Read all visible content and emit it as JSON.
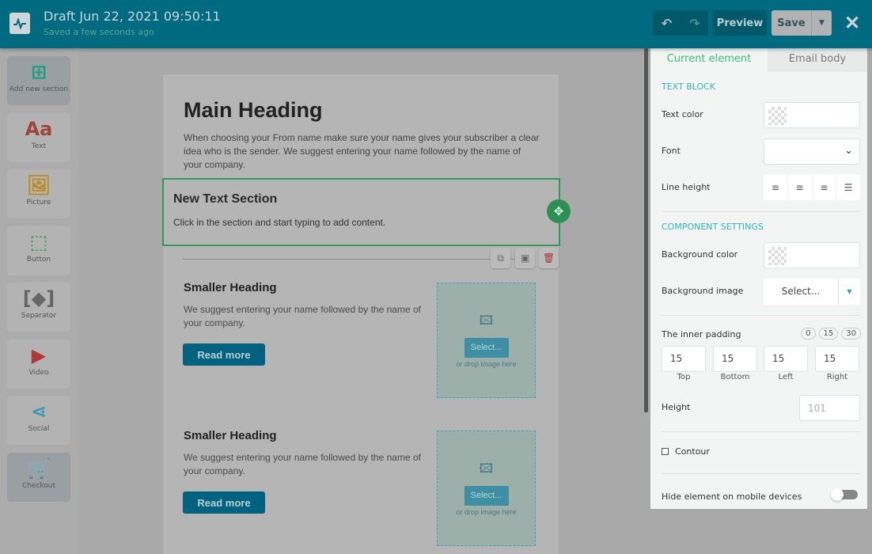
{
  "header": {
    "title": "Draft Jun 22, 2021 09:50:11",
    "status": "Saved a few seconds ago",
    "undo_icon": "↶",
    "redo_icon": "↷",
    "preview": "Preview",
    "save": "Save",
    "save_menu": "▼",
    "close": "✕"
  },
  "sidebar": {
    "items": [
      {
        "label": "Add new section",
        "icon": "⊞",
        "color": "#20a080"
      },
      {
        "label": "Text",
        "icon": "Aa",
        "color": "#a0453a"
      },
      {
        "label": "Picture",
        "icon": "🖼",
        "color": "#c08a20"
      },
      {
        "label": "Button",
        "icon": "⬚",
        "color": "#2a9a50"
      },
      {
        "label": "Separator",
        "icon": "[◆]",
        "color": "#666666"
      },
      {
        "label": "Video",
        "icon": "▶",
        "color": "#b03a3a"
      },
      {
        "label": "Social",
        "icon": "⋖",
        "color": "#3a9ab0"
      },
      {
        "label": "Checkout",
        "icon": "🛒",
        "color": "#c9a520"
      }
    ]
  },
  "email": {
    "main_heading": "Main Heading",
    "intro": "When choosing your From name make sure your name gives your subscriber a clear idea who is the sender. We suggest entering your name followed by the name of your company.",
    "selected": {
      "heading": "New Text Section",
      "body": "Click in the section and start typing to add content."
    },
    "blocks": [
      {
        "heading": "Smaller Heading",
        "body": "We suggest entering your name followed by the name of your company.",
        "button": "Read more",
        "select": "Select...",
        "drop": "or drop image here"
      },
      {
        "heading": "Smaller Heading",
        "body": "We suggest entering your name followed by the name of your company.",
        "button": "Read more",
        "select": "Select...",
        "drop": "or drop image here"
      }
    ]
  },
  "panel": {
    "tabs": [
      "Current element",
      "Email body"
    ],
    "text_block": "TEXT BLOCK",
    "text_color": "Text color",
    "font": "Font",
    "line_height": "Line height",
    "component_settings": "COMPONENT SETTINGS",
    "bg_color": "Background color",
    "bg_image": "Background image",
    "bg_select": "Select...",
    "inner_padding": "The inner padding",
    "presets": [
      "0",
      "15",
      "30"
    ],
    "padding": [
      {
        "label": "Top",
        "value": "15"
      },
      {
        "label": "Bottom",
        "value": "15"
      },
      {
        "label": "Left",
        "value": "15"
      },
      {
        "label": "Right",
        "value": "15"
      }
    ],
    "height": "Height",
    "height_placeholder": "101",
    "contour": "Contour",
    "contour_checked": false,
    "hide_mobile": "Hide element on mobile devices",
    "hide_mobile_on": false
  }
}
